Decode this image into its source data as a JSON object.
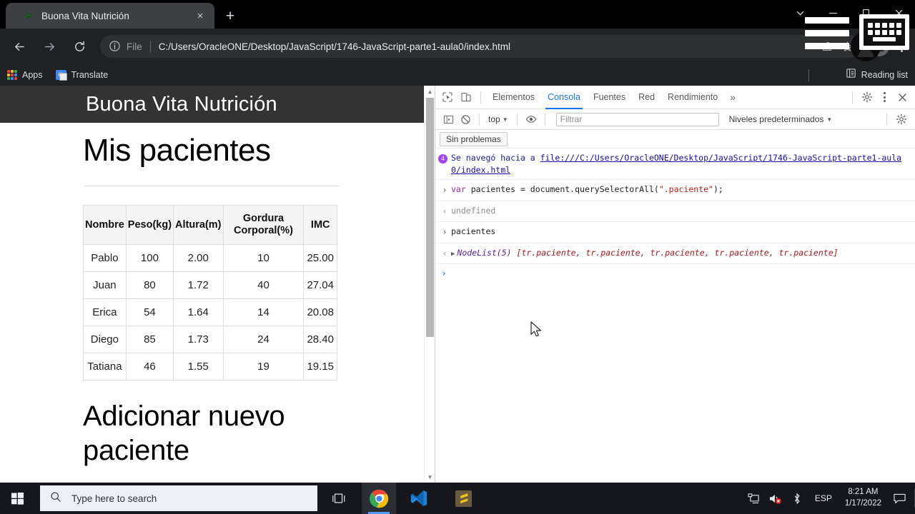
{
  "browser": {
    "tab": {
      "title": "Buona Vita Nutrición",
      "close_label": "×",
      "favicon": "leaf-icon"
    },
    "new_tab_label": "+",
    "window_controls": {
      "collapse": "⌄",
      "minimize": "—",
      "maximize": "❐",
      "close": "✕"
    },
    "omnibox": {
      "scheme_label": "File",
      "url": "C:/Users/OracleONE/Desktop/JavaScript/1746-JavaScript-parte1-aula0/index.html",
      "info_icon": "info-circle-icon",
      "share_icon": "share-icon",
      "star_icon": "bookmark-star-icon"
    },
    "nav": {
      "back": "←",
      "forward": "→",
      "reload": "⟳"
    },
    "bookmarks": [
      {
        "label": "Apps",
        "icon": "apps-grid-icon"
      },
      {
        "label": "Translate",
        "icon": "google-translate-icon"
      }
    ],
    "reading_list": {
      "label": "Reading list",
      "icon": "reading-list-icon"
    }
  },
  "page": {
    "site_title": "Buona Vita Nutrición",
    "heading_patients": "Mis pacientes",
    "heading_add": "Adicionar nuevo paciente",
    "table": {
      "headers": [
        "Nombre",
        "Peso(kg)",
        "Altura(m)",
        "Gordura Corporal(%)",
        "IMC"
      ],
      "rows": [
        [
          "Pablo",
          "100",
          "2.00",
          "10",
          "25.00"
        ],
        [
          "Juan",
          "80",
          "1.72",
          "40",
          "27.04"
        ],
        [
          "Erica",
          "54",
          "1.64",
          "14",
          "20.08"
        ],
        [
          "Diego",
          "85",
          "1.73",
          "24",
          "28.40"
        ],
        [
          "Tatiana",
          "46",
          "1.55",
          "19",
          "19.15"
        ]
      ]
    }
  },
  "devtools": {
    "tabs": [
      {
        "label": "Elementos",
        "active": false
      },
      {
        "label": "Consola",
        "active": true
      },
      {
        "label": "Fuentes",
        "active": false
      },
      {
        "label": "Red",
        "active": false
      },
      {
        "label": "Rendimiento",
        "active": false
      }
    ],
    "more_tabs_label": "»",
    "icons": {
      "inspect": "inspect-element-icon",
      "device": "device-toolbar-icon",
      "settings": "gear-icon",
      "menu": "kebab-menu-icon",
      "close": "close-icon"
    },
    "console_toolbar": {
      "sidebar_toggle": "console-sidebar-icon",
      "clear": "clear-console-icon",
      "context": "top",
      "eye": "live-expression-icon",
      "filter_placeholder": "Filtrar",
      "levels": "Niveles predeterminados",
      "settings": "gear-icon"
    },
    "issues_chip": "Sin problemas",
    "log": [
      {
        "type": "info",
        "badge": "4",
        "text_prefix": "Se navegó hacia a ",
        "link": "file:///C:/Users/OracleONE/Desktop/JavaScript/1746-JavaScript-parte1-aula0/index.html"
      },
      {
        "type": "input",
        "gutter": "›",
        "code_kw": "var",
        "code_mid": " pacientes = document.querySelectorAll(",
        "code_str": "\".paciente\"",
        "code_end": ");"
      },
      {
        "type": "output",
        "gutter": "‹",
        "text": "undefined"
      },
      {
        "type": "input2",
        "gutter": "›",
        "text": "pacientes"
      },
      {
        "type": "nodelist",
        "gutter": "‹",
        "head": "NodeList(5) ",
        "items": "[tr.paciente, tr.paciente, tr.paciente, tr.paciente, tr.paciente]"
      }
    ],
    "prompt": "›"
  },
  "taskbar": {
    "start_icon": "windows-start-icon",
    "search_placeholder": "Type here to search",
    "search_icon": "search-icon",
    "task_view_icon": "task-view-icon",
    "apps": [
      {
        "name": "chrome-icon",
        "active": true
      },
      {
        "name": "vscode-icon",
        "active": false
      },
      {
        "name": "sublime-text-icon",
        "active": false
      }
    ],
    "tray": {
      "network_icon": "monitor-network-icon",
      "volume_icon": "volume-muted-icon",
      "bluetooth_icon": "bluetooth-icon",
      "language": "ESP",
      "time": "8:21 AM",
      "date": "1/17/2022",
      "notifications_icon": "action-center-icon"
    }
  },
  "overlay": {
    "hamburger_icon": "overlay-menu-icon",
    "keyboard_icon": "on-screen-keyboard-icon"
  },
  "colors": {
    "chrome_dark": "#202124",
    "page_header": "#333333",
    "devtools_accent": "#1a73e8",
    "badge_purple": "#a142f4",
    "taskbar": "#15171c"
  }
}
